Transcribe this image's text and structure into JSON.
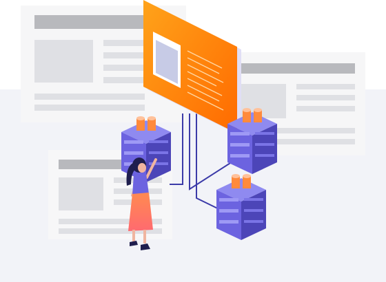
{
  "illustration": {
    "subject": "",
    "icons": [
      "web-page-card-icon",
      "monitor-panel-icon",
      "server-stack-icon",
      "person-icon"
    ],
    "colors": {
      "background_band": "#f2f3f8",
      "card_bg": "#f4f4f5",
      "card_header": "#b8b9bd",
      "card_line": "#dfe0e4",
      "panel_orange": "#ff8a00",
      "panel_orange_dark": "#ff6f00",
      "server_purple": "#6c63e0",
      "server_purple_light": "#8f8af0",
      "server_purple_dark": "#4c45b8",
      "cable": "#3b3aa8",
      "skin": "#f0b5a0",
      "skirt_orange": "#ff7a3c",
      "hair": "#1f1e4e"
    }
  }
}
